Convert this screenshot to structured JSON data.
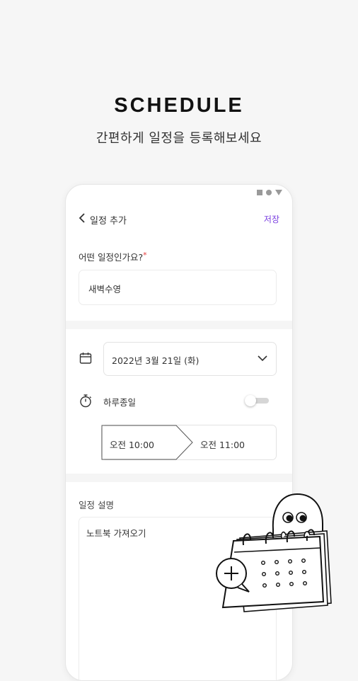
{
  "headline": "SCHEDULE",
  "subline": "간편하게 일정을 등록해보세요",
  "app_bar": {
    "title": "일정 추가",
    "save_label": "저장",
    "accent": "#7a3fe0"
  },
  "form": {
    "question_label": "어떤 일정인가요?",
    "required_mark": "*",
    "title_value": "새벽수영",
    "date_value": "2022년 3월 21일 (화)",
    "all_day_label": "하루종일",
    "all_day_on": false,
    "start_time": "오전 10:00",
    "end_time": "오전 11:00",
    "description_label": "일정 설명",
    "description_value": "노트북 가져오기"
  },
  "icons": {
    "back": "chevron-left-icon",
    "calendar": "calendar-icon",
    "timer": "stopwatch-icon",
    "dropdown": "chevron-down-icon"
  }
}
